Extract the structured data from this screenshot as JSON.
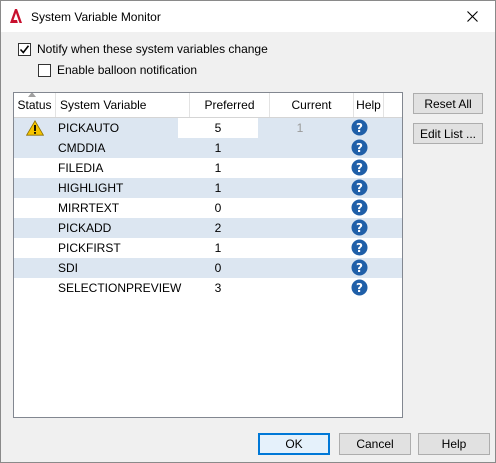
{
  "window": {
    "title": "System Variable Monitor"
  },
  "options": {
    "notify_label": "Notify when these system variables change",
    "notify_checked": true,
    "balloon_label": "Enable balloon notification",
    "balloon_checked": false
  },
  "table": {
    "columns": [
      "Status",
      "System Variable",
      "Preferred",
      "Current",
      "Help"
    ],
    "rows": [
      {
        "status": "warning",
        "name": "PICKAUTO",
        "preferred": "5",
        "current": "1"
      },
      {
        "status": "",
        "name": "CMDDIA",
        "preferred": "1",
        "current": ""
      },
      {
        "status": "",
        "name": "FILEDIA",
        "preferred": "1",
        "current": ""
      },
      {
        "status": "",
        "name": "HIGHLIGHT",
        "preferred": "1",
        "current": ""
      },
      {
        "status": "",
        "name": "MIRRTEXT",
        "preferred": "0",
        "current": ""
      },
      {
        "status": "",
        "name": "PICKADD",
        "preferred": "2",
        "current": ""
      },
      {
        "status": "",
        "name": "PICKFIRST",
        "preferred": "1",
        "current": ""
      },
      {
        "status": "",
        "name": "SDI",
        "preferred": "0",
        "current": ""
      },
      {
        "status": "",
        "name": "SELECTIONPREVIEW",
        "preferred": "3",
        "current": ""
      }
    ]
  },
  "side_buttons": {
    "reset_all": "Reset All",
    "edit_list": "Edit List ..."
  },
  "footer_buttons": {
    "ok": "OK",
    "cancel": "Cancel",
    "help": "Help"
  },
  "colors": {
    "alt_row": "#dce6f1",
    "help_icon": "#1f5fa8",
    "warning": "#f5c400",
    "default_button_border": "#0078d7"
  }
}
